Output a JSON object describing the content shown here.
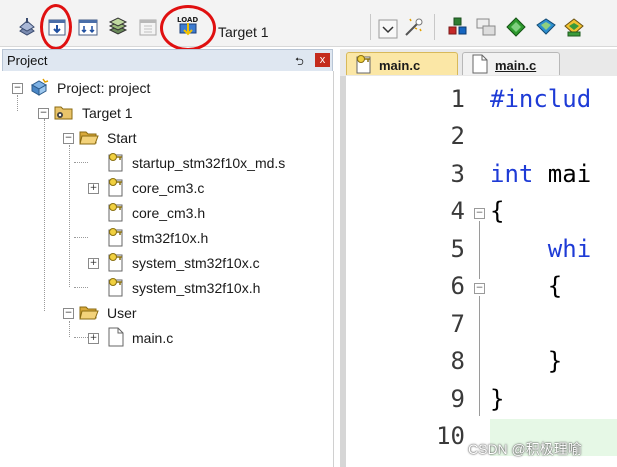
{
  "toolbar": {
    "target_label": "Target 1",
    "icons": [
      "translate-icon",
      "build-icon",
      "rebuild-icon",
      "batch-build-icon",
      "stop-build-icon",
      "load-icon",
      "target-dropdown-icon",
      "options-icon",
      "manage-components-icon",
      "window-layout-icon",
      "select-pack-icon",
      "pack-installer-icon",
      "run-environment-icon"
    ],
    "load_text": "LOAD",
    "annotation_color": "#e01010"
  },
  "project_panel": {
    "title": "Project",
    "pin_glyph": "⮌",
    "close_glyph": "x",
    "tree": {
      "root": "Project: project",
      "target": "Target 1",
      "groups": [
        {
          "name": "Start",
          "files": [
            "startup_stm32f10x_md.s",
            "core_cm3.c",
            "core_cm3.h",
            "stm32f10x.h",
            "system_stm32f10x.c",
            "system_stm32f10x.h"
          ]
        },
        {
          "name": "User",
          "files": [
            "main.c"
          ]
        }
      ]
    }
  },
  "editor": {
    "tabs": [
      "main.c",
      "main.c"
    ],
    "line_numbers": [
      "1",
      "2",
      "3",
      "4",
      "5",
      "6",
      "7",
      "8",
      "9",
      "10"
    ],
    "lines": [
      {
        "kw": "#includ",
        "rest": ""
      },
      {
        "kw": "",
        "rest": ""
      },
      {
        "kw": "int",
        "rest": " mai"
      },
      {
        "kw": "",
        "rest": "{"
      },
      {
        "kw": "    whi",
        "rest": ""
      },
      {
        "kw": "",
        "rest": "    {"
      },
      {
        "kw": "",
        "rest": ""
      },
      {
        "kw": "",
        "rest": "    }"
      },
      {
        "kw": "",
        "rest": "}"
      },
      {
        "kw": "",
        "rest": ""
      }
    ]
  },
  "watermark": "CSDN @积极理喻"
}
